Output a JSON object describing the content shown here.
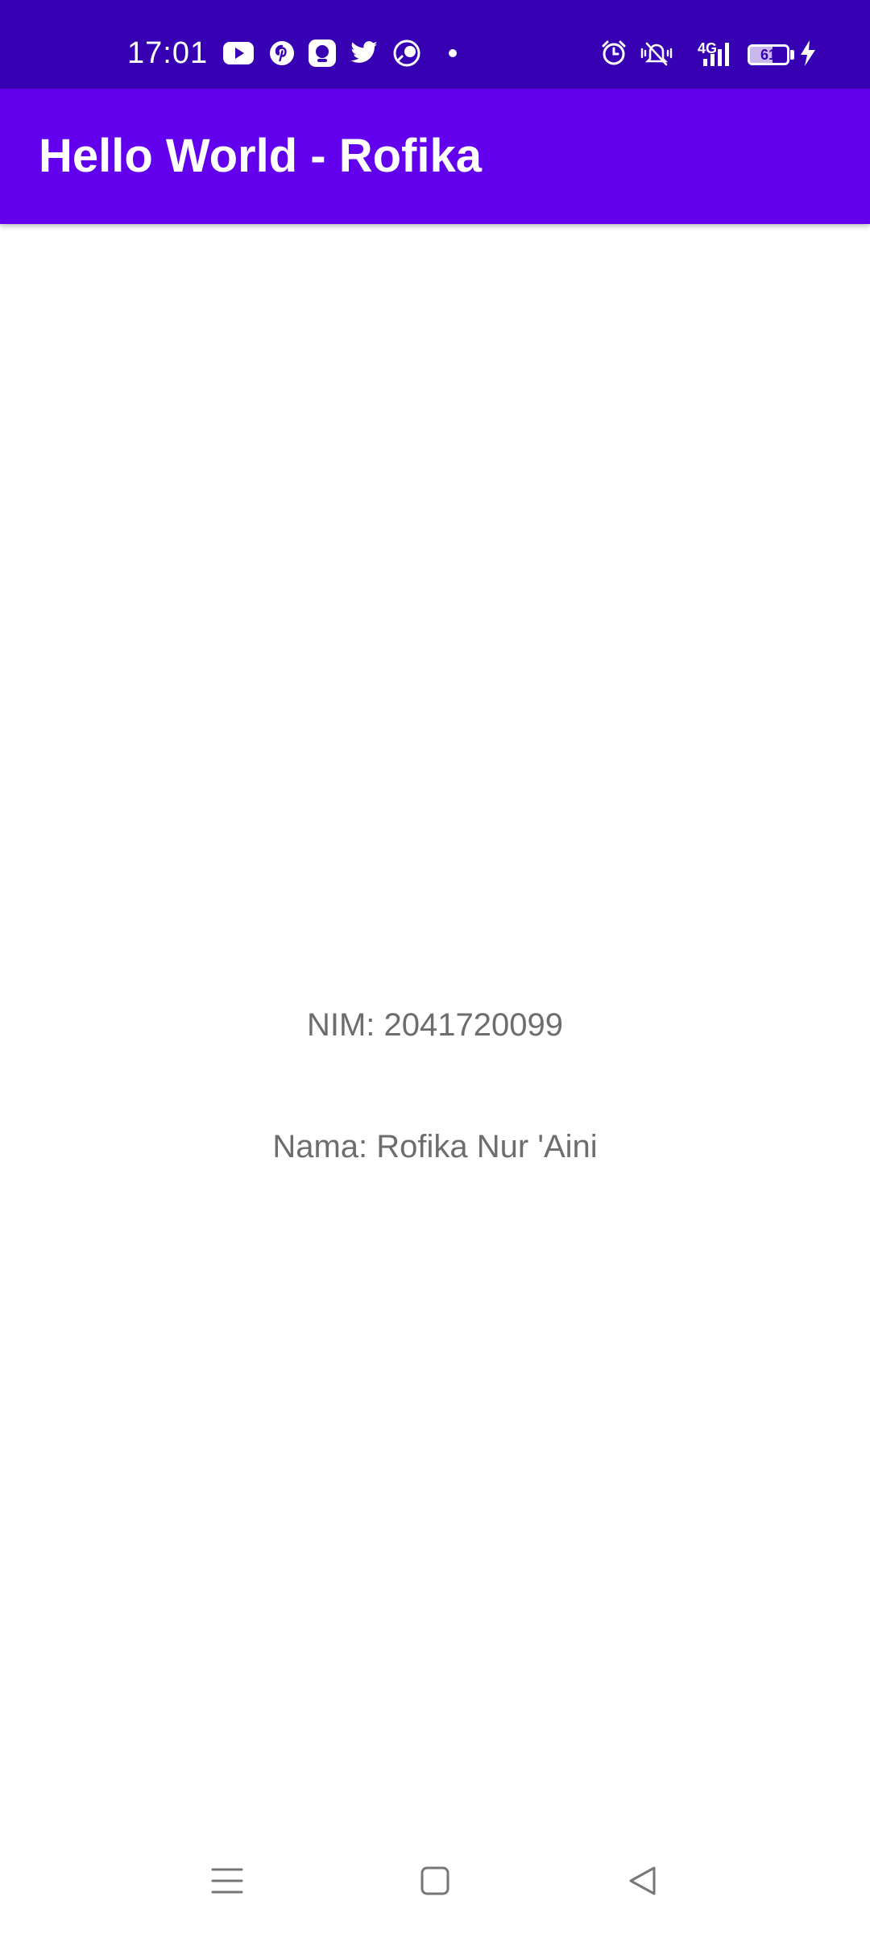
{
  "status_bar": {
    "time": "17:01",
    "network": "4G",
    "battery_level": "61",
    "background_color": "#3700B3",
    "notification_icons": [
      "youtube-icon",
      "pinterest-icon",
      "messenger-icon",
      "twitter-icon",
      "browser-icon",
      "dot-icon"
    ],
    "system_icons": [
      "alarm-icon",
      "vibrate-icon",
      "signal-icon",
      "battery-icon",
      "charging-icon"
    ]
  },
  "app_bar": {
    "title": "Hello World - Rofika",
    "background_color": "#6200EE"
  },
  "content": {
    "nim": "NIM: 2041720099",
    "nama": "Nama: Rofika Nur 'Aini",
    "text_color": "#6d6d6d"
  },
  "nav_bar": {
    "buttons": [
      "menu-icon",
      "home-icon",
      "back-icon"
    ]
  }
}
